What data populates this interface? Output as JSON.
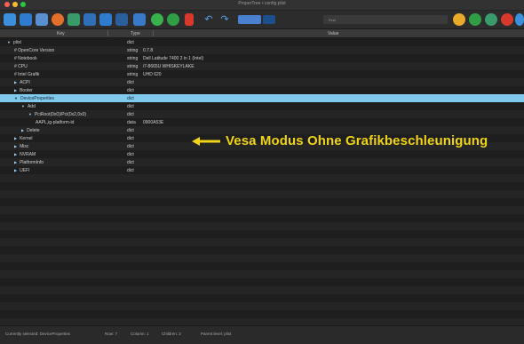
{
  "window": {
    "title": "ProperTree  •  config.plist"
  },
  "colors": {
    "selection": "#80c8ec",
    "annotation": "#f0d418"
  },
  "toolbar": {
    "icons": [
      "open-icon",
      "save-icon",
      "view-icon",
      "clock-icon",
      "tree-icon",
      "expand-icon",
      "grid-icon",
      "list-icon",
      "add-icon",
      "remove-icon",
      "bookmark-icon",
      "undo-icon",
      "redo-icon",
      "toggle-icon",
      "search-icon",
      "sync-icon",
      "check-icon",
      "info-icon",
      "settings-icon"
    ],
    "search_placeholder": "Find"
  },
  "header": {
    "key": "Key",
    "type": "Type",
    "value": "Value"
  },
  "rows": [
    {
      "key": "plist",
      "type": "dict",
      "value": "",
      "indent": 0,
      "expand": "▼"
    },
    {
      "key": "# OpenCore Version",
      "type": "string",
      "value": "0.7.8",
      "indent": 1,
      "expand": ""
    },
    {
      "key": "# Notebook",
      "type": "string",
      "value": "Dell Latitude 7400 2 in 1 (Intel)",
      "indent": 1,
      "expand": ""
    },
    {
      "key": "# CPU",
      "type": "string",
      "value": "i7-8665U WHISKEYLAKE",
      "indent": 1,
      "expand": ""
    },
    {
      "key": "# Intel Grafik",
      "type": "string",
      "value": "UHD 620",
      "indent": 1,
      "expand": ""
    },
    {
      "key": "ACPI",
      "type": "dict",
      "value": "",
      "indent": 1,
      "expand": "▶"
    },
    {
      "key": "Booter",
      "type": "dict",
      "value": "",
      "indent": 1,
      "expand": "▶"
    },
    {
      "key": "DeviceProperties",
      "type": "dict",
      "value": "",
      "indent": 1,
      "expand": "▼"
    },
    {
      "key": "Add",
      "type": "dict",
      "value": "",
      "indent": 2,
      "expand": "▼"
    },
    {
      "key": "PciRoot(0x0)/Pci(0x2,0x0)",
      "type": "dict",
      "value": "",
      "indent": 3,
      "expand": "▼"
    },
    {
      "key": "AAPL,ig-platform-id",
      "type": "data",
      "value": "0900A53E",
      "indent": 4,
      "expand": ""
    },
    {
      "key": "Delete",
      "type": "dict",
      "value": "",
      "indent": 2,
      "expand": "▶"
    },
    {
      "key": "Kernel",
      "type": "dict",
      "value": "",
      "indent": 1,
      "expand": "▶"
    },
    {
      "key": "Misc",
      "type": "dict",
      "value": "",
      "indent": 1,
      "expand": "▶"
    },
    {
      "key": "NVRAM",
      "type": "dict",
      "value": "",
      "indent": 1,
      "expand": "▶"
    },
    {
      "key": "PlatformInfo",
      "type": "dict",
      "value": "",
      "indent": 1,
      "expand": "▶"
    },
    {
      "key": "UEFI",
      "type": "dict",
      "value": "",
      "indent": 1,
      "expand": "▶"
    }
  ],
  "selected_index": 7,
  "annotation": {
    "text": "Vesa Modus Ohne Grafikbeschleunigung"
  },
  "statusbar": {
    "selected": "Currently selected: DeviceProperties",
    "row": "Row: 7",
    "column": "Column: 1",
    "children": "Children: 2",
    "parent": "Parent level: plist"
  }
}
